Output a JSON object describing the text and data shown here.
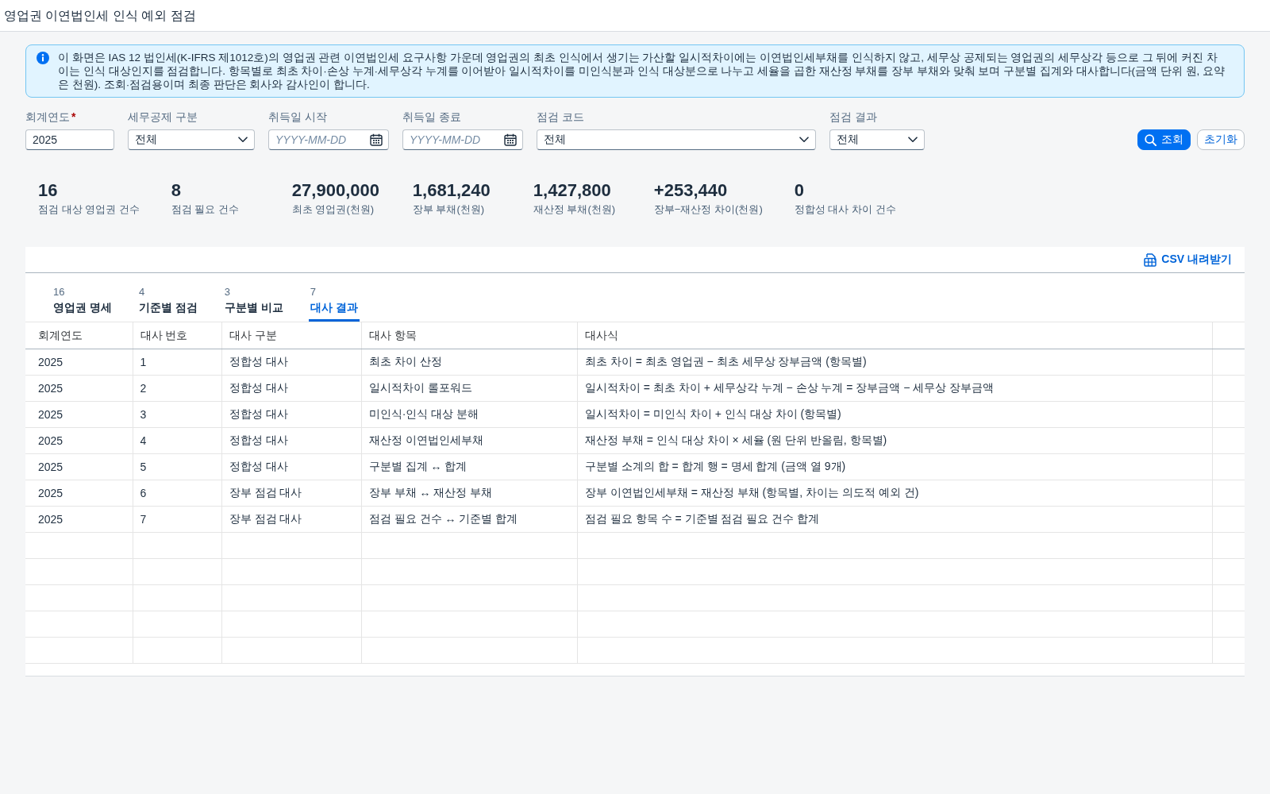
{
  "window": {
    "title": "영업권 이연법인세 인식 예외 점검"
  },
  "info_banner": {
    "text": "이 화면은 IAS 12 법인세(K-IFRS 제1012호)의 영업권 관련 이연법인세 요구사항 가운데 영업권의 최초 인식에서 생기는 가산할 일시적차이에는 이연법인세부채를 인식하지 않고, 세무상 공제되는 영업권의 세무상각 등으로 그 뒤에 커진 차이는 인식 대상인지를 점검합니다. 항목별로 최초 차이·손상 누계·세무상각 누계를 이어받아 일시적차이를 미인식분과 인식 대상분으로 나누고 세율을 곱한 재산정 부채를 장부 부채와 맞춰 보며 구분별 집계와 대사합니다(금액 단위 원, 요약은 천원). 조회·점검용이며 최종 판단은 회사와 감사인이 합니다."
  },
  "filters": [
    {
      "kind": "text",
      "label": "회계연도",
      "required_mark": "*",
      "value": "2025"
    },
    {
      "kind": "select",
      "label": "세무공제 구분",
      "value": "전체"
    },
    {
      "kind": "date",
      "label": "취득일 시작",
      "placeholder": "YYYY-MM-DD"
    },
    {
      "kind": "date",
      "label": "취득일 종료",
      "placeholder": "YYYY-MM-DD"
    },
    {
      "kind": "select",
      "label": "점검 코드",
      "value": "전체"
    },
    {
      "kind": "select",
      "label": "점검 결과",
      "value": "전체"
    }
  ],
  "actions": [
    {
      "kind": "primary",
      "label": "조회"
    },
    {
      "kind": "secondary",
      "label": "초기화"
    }
  ],
  "kpis": [
    {
      "value": "16",
      "label": "점검 대상 영업권 건수"
    },
    {
      "value": "8",
      "label": "점검 필요 건수"
    },
    {
      "value": "27,900,000",
      "label": "최초 영업권(천원)"
    },
    {
      "value": "1,681,240",
      "label": "장부 부채(천원)"
    },
    {
      "value": "1,427,800",
      "label": "재산정 부채(천원)"
    },
    {
      "value": "+253,440",
      "label": "장부−재산정 차이(천원)"
    },
    {
      "value": "0",
      "label": "정합성 대사 차이 건수"
    }
  ],
  "panel": {
    "toolbar": {
      "download_label": "CSV 내려받기"
    },
    "tabs": [
      {
        "count": "16",
        "label": "영업권 명세",
        "selected": false
      },
      {
        "count": "4",
        "label": "기준별 점검",
        "selected": false
      },
      {
        "count": "3",
        "label": "구분별 비교",
        "selected": false
      },
      {
        "count": "7",
        "label": "대사 결과",
        "selected": true
      }
    ],
    "table": {
      "columns": [
        "회계연도",
        "대사 번호",
        "대사 구분",
        "대사 항목",
        "대사식"
      ],
      "rows": [
        [
          "2025",
          "1",
          "정합성 대사",
          "최초 차이 산정",
          "최초 차이 = 최초 영업권 − 최초 세무상 장부금액 (항목별)"
        ],
        [
          "2025",
          "2",
          "정합성 대사",
          "일시적차이 롤포워드",
          "일시적차이 = 최초 차이 + 세무상각 누계 − 손상 누계 = 장부금액 − 세무상 장부금액"
        ],
        [
          "2025",
          "3",
          "정합성 대사",
          "미인식·인식 대상 분해",
          "일시적차이 = 미인식 차이 + 인식 대상 차이 (항목별)"
        ],
        [
          "2025",
          "4",
          "정합성 대사",
          "재산정 이연법인세부채",
          "재산정 부채 = 인식 대상 차이 × 세율 (원 단위 반올림, 항목별)"
        ],
        [
          "2025",
          "5",
          "정합성 대사",
          "구분별 집계 ↔ 합계",
          "구분별 소계의 합 = 합계 행 = 명세 합계 (금액 열 9개)"
        ],
        [
          "2025",
          "6",
          "장부 점검 대사",
          "장부 부채 ↔ 재산정 부채",
          "장부 이연법인세부채 = 재산정 부채 (항목별, 차이는 의도적 예외 건)"
        ],
        [
          "2025",
          "7",
          "장부 점검 대사",
          "점검 필요 건수 ↔ 기준별 합계",
          "점검 필요 항목 수 = 기준별 점검 필요 건수 합계"
        ]
      ]
    }
  }
}
